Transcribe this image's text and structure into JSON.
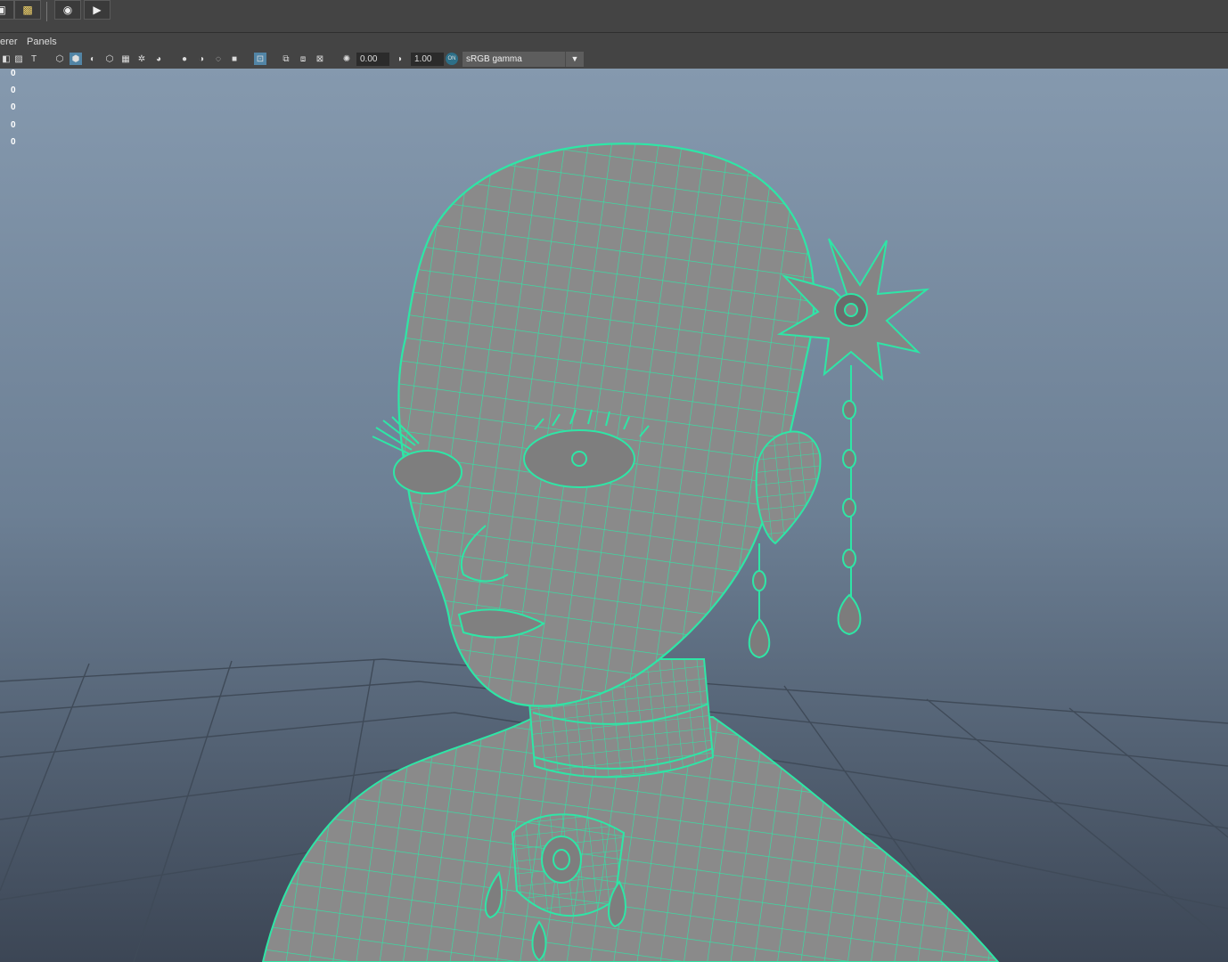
{
  "shelf": {
    "icons": [
      "render-settings-icon",
      "hypershade-icon",
      "show-icon",
      "playblast-icon"
    ]
  },
  "menu": {
    "items": [
      "erer",
      "Panels"
    ]
  },
  "toolbar": {
    "exposure_value": "0.00",
    "gamma_value": "1.00",
    "color_space": "sRGB gamma",
    "color_management_badge": "ON"
  },
  "hud": {
    "values": [
      "0",
      "0",
      "0",
      "0",
      "0"
    ]
  },
  "colors": {
    "wireframe": "#2ee6a6",
    "mesh": "#8a8a8a",
    "viewport_top": "#8599ae",
    "viewport_bottom": "#3c4655",
    "active_button": "#5285a6"
  }
}
